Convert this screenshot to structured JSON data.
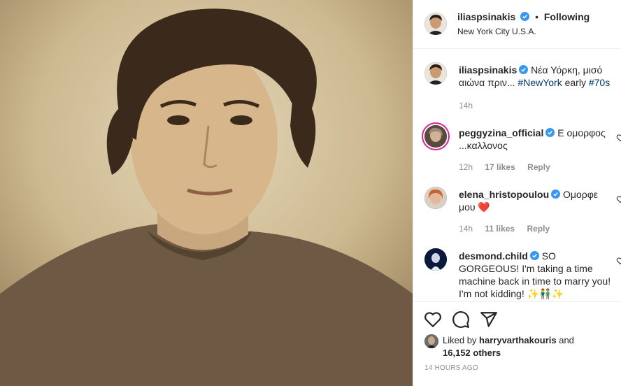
{
  "post": {
    "username": "iliaspsinakis",
    "follow_label": "Following",
    "dot": "•",
    "location": "New York City U.S.A."
  },
  "caption": {
    "username": "iliaspsinakis",
    "text": "Νέα Υόρκη, μισό αιώνα πριν... ",
    "tag1": "#NewYork",
    "text2": " early ",
    "tag2": "#70s",
    "time": "14h"
  },
  "comments": [
    {
      "username": "peggyzina_official",
      "text": "Ε ομορφος ...καλλονος",
      "time": "12h",
      "likes": "17 likes",
      "reply": "Reply"
    },
    {
      "username": "elena_hristopoulou",
      "text": "Ομορφε μου",
      "emoji": "❤️",
      "time": "14h",
      "likes": "11 likes",
      "reply": "Reply"
    },
    {
      "username": "desmond.child",
      "text": "SO GORGEOUS! I'm taking a time machine back in time to marry you! I'm not kidding! ",
      "emoji": "✨👬✨"
    }
  ],
  "likes": {
    "prefix": "Liked by ",
    "user": "harryvarthakouris",
    "middle": " and ",
    "count": "16,152 others"
  },
  "timestamp": "14 HOURS AGO",
  "icons": [
    "verified-icon",
    "heart-icon",
    "comment-icon",
    "share-icon"
  ],
  "colors": {
    "link": "#00376b",
    "verified": "#3897f0",
    "meta": "#8e8e8e"
  }
}
